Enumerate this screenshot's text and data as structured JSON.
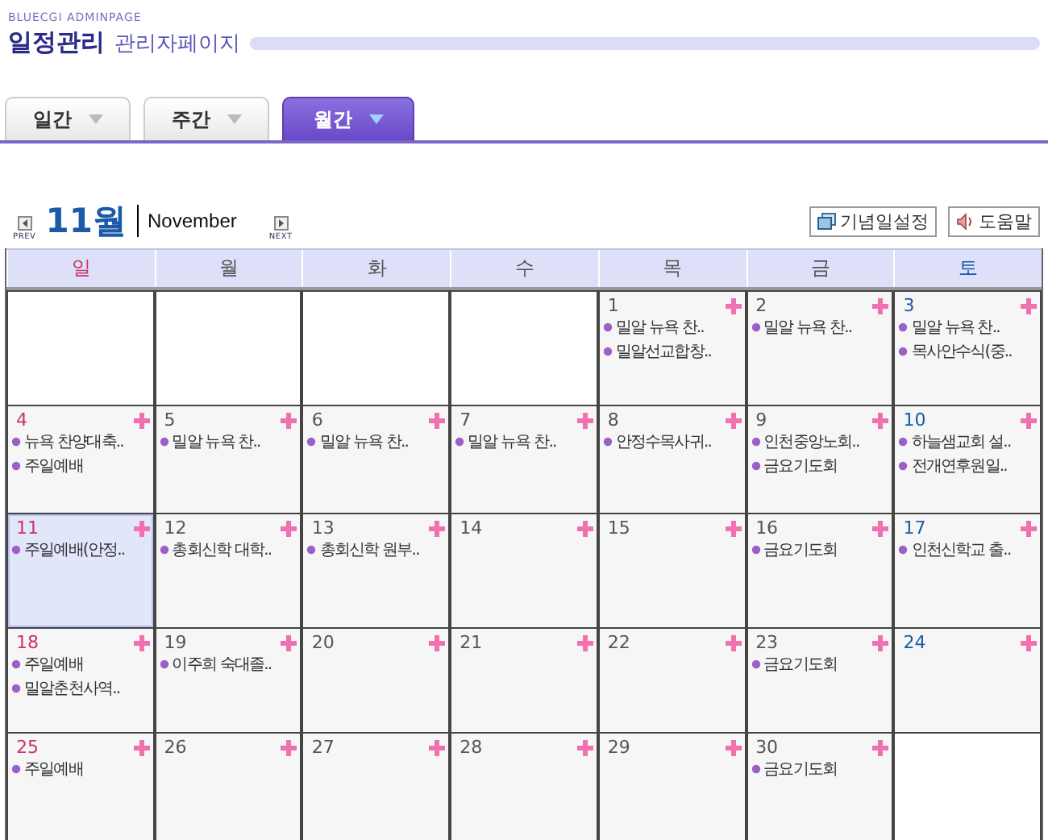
{
  "header": {
    "brand": "BLUECGI ADMINPAGE",
    "title": "일정관리",
    "subtitle": "관리자페이지"
  },
  "tabs": [
    {
      "label": "일간",
      "selected": false
    },
    {
      "label": "주간",
      "selected": false
    },
    {
      "label": "월간",
      "selected": true
    }
  ],
  "month_nav": {
    "prev": "PREV",
    "month": "11월",
    "english": "November",
    "next": "NEXT"
  },
  "actions": [
    "기념일설정",
    "도움말"
  ],
  "weekdays": [
    {
      "label": "일",
      "color": "#cc3366"
    },
    {
      "label": "월",
      "color": "#555555"
    },
    {
      "label": "화",
      "color": "#555555"
    },
    {
      "label": "수",
      "color": "#555555"
    },
    {
      "label": "목",
      "color": "#555555"
    },
    {
      "label": "금",
      "color": "#555555"
    },
    {
      "label": "토",
      "color": "#1a5aa8"
    }
  ],
  "weeks": [
    [
      {
        "kind": "empty"
      },
      {
        "kind": "empty"
      },
      {
        "kind": "empty"
      },
      {
        "kind": "empty"
      },
      {
        "kind": "day",
        "day": "1",
        "today": false,
        "events": [
          "밀알 뉴욕 찬..",
          "밀알선교합창.."
        ]
      },
      {
        "kind": "day",
        "day": "2",
        "today": false,
        "events": [
          "밀알 뉴욕 찬.."
        ]
      },
      {
        "kind": "day",
        "day": "3",
        "today": false,
        "events": [
          "밀알 뉴욕 찬..",
          "목사안수식(중.."
        ]
      }
    ],
    [
      {
        "kind": "day",
        "day": "4",
        "today": false,
        "events": [
          "뉴욕 찬양대축..",
          "주일예배"
        ]
      },
      {
        "kind": "day",
        "day": "5",
        "today": false,
        "events": [
          "밀알 뉴욕 찬.."
        ]
      },
      {
        "kind": "day",
        "day": "6",
        "today": false,
        "events": [
          "밀알 뉴욕 찬.."
        ]
      },
      {
        "kind": "day",
        "day": "7",
        "today": false,
        "events": [
          "밀알 뉴욕 찬.."
        ]
      },
      {
        "kind": "day",
        "day": "8",
        "today": false,
        "events": [
          "안정수목사귀.."
        ]
      },
      {
        "kind": "day",
        "day": "9",
        "today": false,
        "events": [
          "인천중앙노회..",
          "금요기도회"
        ]
      },
      {
        "kind": "day",
        "day": "10",
        "today": false,
        "events": [
          "하늘샘교회 설..",
          "전개연후원일.."
        ]
      }
    ],
    [
      {
        "kind": "day",
        "day": "11",
        "today": true,
        "events": [
          "주일예배(안정.."
        ]
      },
      {
        "kind": "day",
        "day": "12",
        "today": false,
        "events": [
          "총회신학 대학.."
        ]
      },
      {
        "kind": "day",
        "day": "13",
        "today": false,
        "events": [
          "총회신학 원부.."
        ]
      },
      {
        "kind": "day",
        "day": "14",
        "today": false
      },
      {
        "kind": "day",
        "day": "15",
        "today": false
      },
      {
        "kind": "day",
        "day": "16",
        "today": false,
        "events": [
          "금요기도회"
        ]
      },
      {
        "kind": "day",
        "day": "17",
        "today": false,
        "events": [
          "인천신학교 출.."
        ]
      }
    ],
    [
      {
        "kind": "day",
        "day": "18",
        "today": false,
        "events": [
          "주일예배",
          "밀알춘천사역.."
        ]
      },
      {
        "kind": "day",
        "day": "19",
        "today": false,
        "events": [
          "이주희 숙대졸.."
        ]
      },
      {
        "kind": "day",
        "day": "20",
        "today": false
      },
      {
        "kind": "day",
        "day": "21",
        "today": false
      },
      {
        "kind": "day",
        "day": "22",
        "today": false
      },
      {
        "kind": "day",
        "day": "23",
        "today": false,
        "events": [
          "금요기도회"
        ]
      },
      {
        "kind": "day",
        "day": "24",
        "today": false
      }
    ],
    [
      {
        "kind": "day",
        "day": "25",
        "today": false,
        "events": [
          "주일예배"
        ]
      },
      {
        "kind": "day",
        "day": "26",
        "today": false
      },
      {
        "kind": "day",
        "day": "27",
        "today": false
      },
      {
        "kind": "day",
        "day": "28",
        "today": false
      },
      {
        "kind": "day",
        "day": "29",
        "today": false
      },
      {
        "kind": "day",
        "day": "30",
        "today": false,
        "events": [
          "금요기도회"
        ]
      },
      {
        "kind": "empty"
      }
    ]
  ]
}
